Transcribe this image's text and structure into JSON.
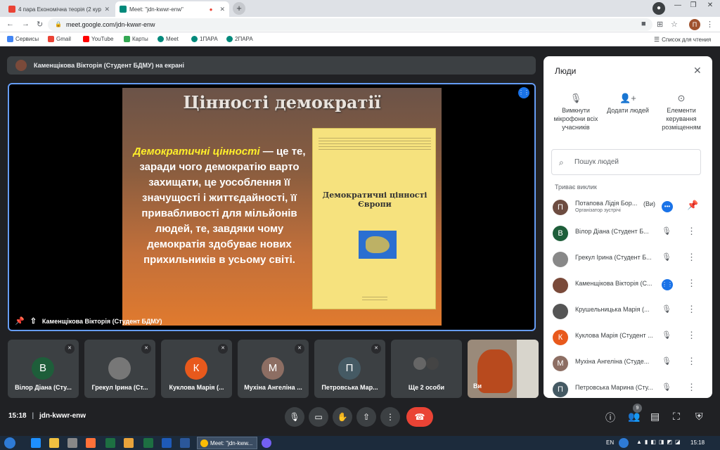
{
  "browser": {
    "tabs": [
      {
        "title": "4 пара Економічна теорія (2 кур",
        "icon": "gmail-icon"
      },
      {
        "title": "Meet: \"jdn-kwwr-enw\"",
        "icon": "meet-icon"
      }
    ],
    "url": "meet.google.com/jdn-kwwr-enw",
    "profile_initial": "П",
    "bookmarks": [
      "Сервисы",
      "Gmail",
      "YouTube",
      "Карты",
      "Meet",
      "1ПАРА",
      "2ПАРА"
    ],
    "reading_list": "Список для чтения"
  },
  "meet": {
    "presenting_banner": "Каменщікова Вікторія (Студент БДМУ) на екрані",
    "main_label": "Каменщікова Вікторія (Студент БДМУ)",
    "slide": {
      "title": "Цінності демократії",
      "highlight": "Демократичні цінності",
      "body": " — це те, заради чого демократію варто захищати, це уособлення її значущості і життєдайності, її привабливості для мільйонів людей, те, завдяки чому демократія здобуває нових прихильників в усьому світі.",
      "book_title": "Демократичні цінності Європи"
    },
    "tiles": [
      {
        "initial": "В",
        "name": "Вілор Діана (Сту...",
        "color": "#1e5e3a"
      },
      {
        "initial": "",
        "name": "Грекул Ірина (Ст...",
        "color": "#777"
      },
      {
        "initial": "К",
        "name": "Куклова Марія (...",
        "color": "#e8591c"
      },
      {
        "initial": "М",
        "name": "Мухіна Ангеліна ...",
        "color": "#8d6e63"
      },
      {
        "initial": "П",
        "name": "Петровська Мар...",
        "color": "#455a64"
      },
      {
        "initial": "",
        "name": "Ще 2 особи",
        "color": ""
      },
      {
        "initial": "",
        "name": "Ви",
        "color": ""
      }
    ],
    "time": "15:18",
    "meeting_code": "jdn-kwwr-enw",
    "people_count": "9"
  },
  "panel": {
    "title": "Люди",
    "actions": [
      {
        "label": "Вимкнути мікрофони всіх учасників",
        "icon": "mic-off-icon"
      },
      {
        "label": "Додати людей",
        "icon": "add-person-icon"
      },
      {
        "label": "Елементи керування розміщенням",
        "icon": "toggle-icon"
      }
    ],
    "search_placeholder": "Пошук людей",
    "section": "Триває виклик",
    "participants": [
      {
        "initial": "П",
        "name": "Потапова Лідія Бор...",
        "sub": "Організатор зустрічі",
        "you": "(Ви)",
        "color": "#6d4c41"
      },
      {
        "initial": "В",
        "name": "Вілор Діана (Студент Б...",
        "sub": "",
        "you": "",
        "color": "#1e5e3a"
      },
      {
        "initial": "",
        "name": "Грекул Ірина (Студент Б...",
        "sub": "",
        "you": "",
        "color": "#888"
      },
      {
        "initial": "",
        "name": "Каменщікова Вікторія (С...",
        "sub": "",
        "you": "",
        "color": "#7a4a3a"
      },
      {
        "initial": "",
        "name": "Крушельницька Марія (...",
        "sub": "",
        "you": "",
        "color": "#555"
      },
      {
        "initial": "К",
        "name": "Куклова Марія (Студент ...",
        "sub": "",
        "you": "",
        "color": "#e8591c"
      },
      {
        "initial": "М",
        "name": "Мухіна Ангеліна (Студе...",
        "sub": "",
        "you": "",
        "color": "#8d6e63"
      },
      {
        "initial": "П",
        "name": "Петровська Марина (Сту...",
        "sub": "",
        "you": "",
        "color": "#455a64"
      }
    ]
  },
  "taskbar": {
    "active_window": "Meet: \"jdn-kww...",
    "lang": "EN",
    "clock": "15:18"
  }
}
